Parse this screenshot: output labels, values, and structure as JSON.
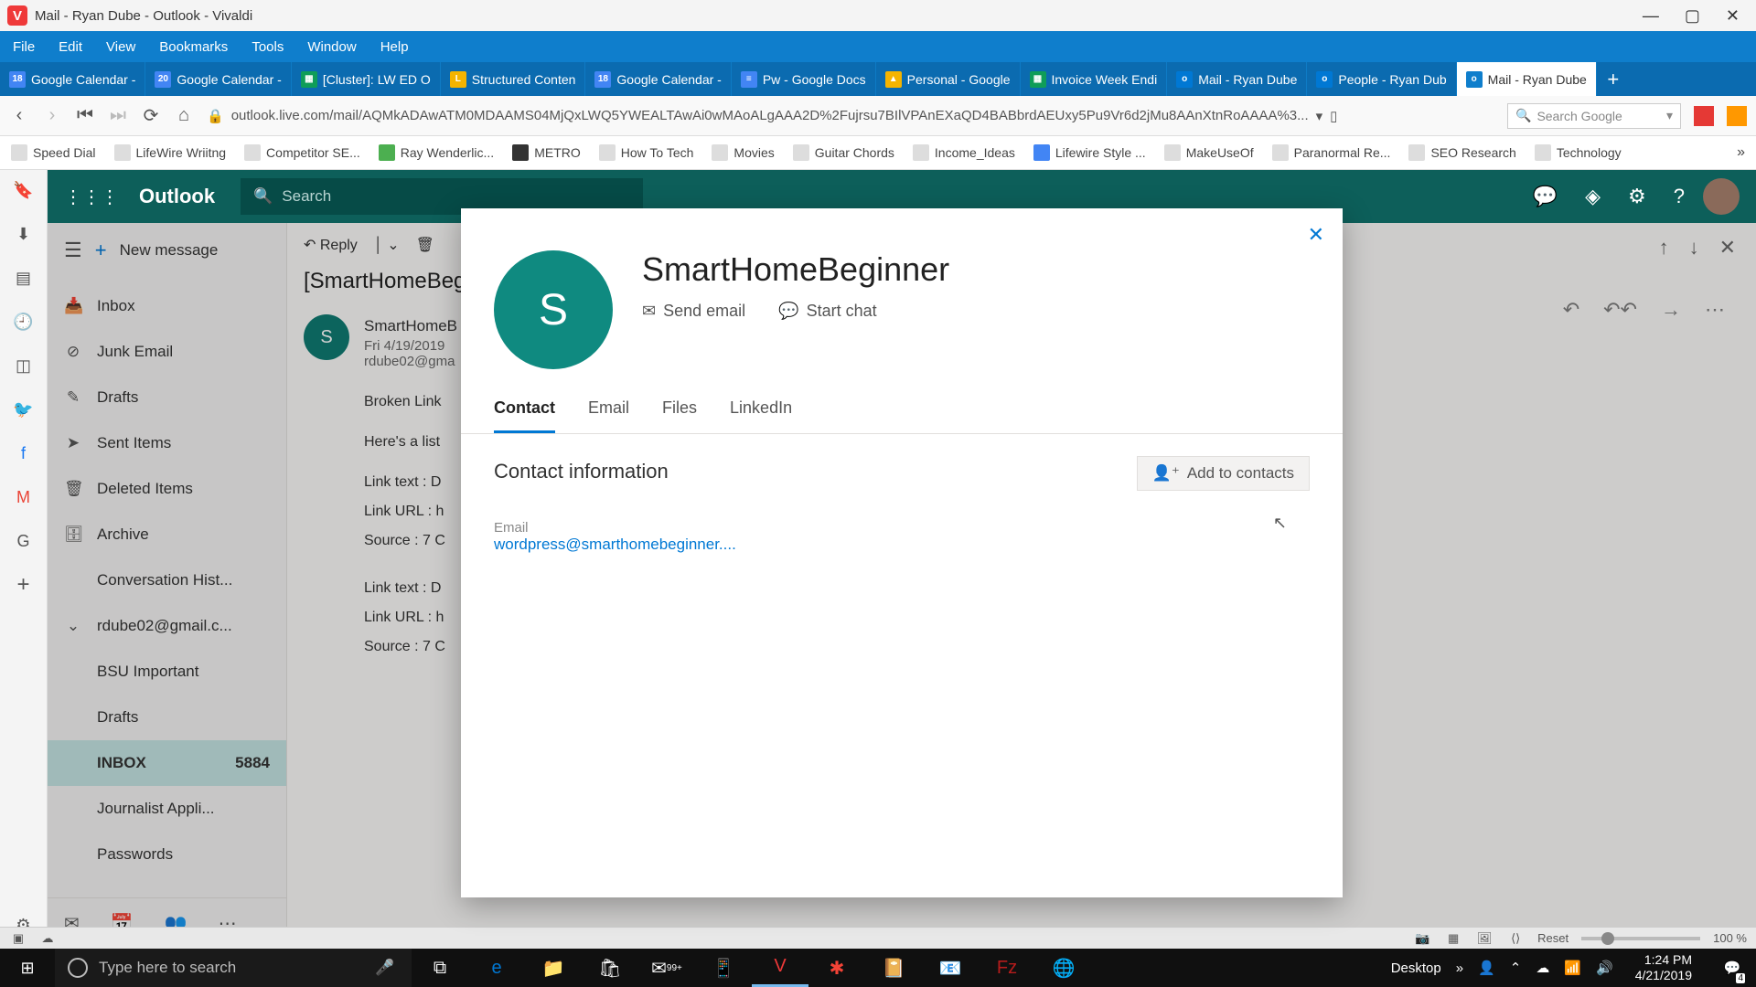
{
  "window": {
    "title": "Mail - Ryan Dube - Outlook - Vivaldi",
    "menu": [
      "File",
      "Edit",
      "View",
      "Bookmarks",
      "Tools",
      "Window",
      "Help"
    ]
  },
  "tabs": [
    {
      "icon": "18",
      "label": "Google Calendar -"
    },
    {
      "icon": "20",
      "label": "Google Calendar -"
    },
    {
      "icon": "▦",
      "label": "[Cluster]: LW ED O"
    },
    {
      "icon": "L",
      "label": "Structured Conten"
    },
    {
      "icon": "18",
      "label": "Google Calendar -"
    },
    {
      "icon": "≡",
      "label": "Pw - Google Docs"
    },
    {
      "icon": "▲",
      "label": "Personal - Google"
    },
    {
      "icon": "▦",
      "label": "Invoice Week Endi"
    },
    {
      "icon": "o",
      "label": "Mail - Ryan Dube"
    },
    {
      "icon": "o",
      "label": "People - Ryan Dub"
    },
    {
      "icon": "o",
      "label": "Mail - Ryan Dube",
      "active": true
    }
  ],
  "url": "outlook.live.com/mail/AQMkADAwATM0MDAAMS04MjQxLWQ5YWEALTAwAi0wMAoALgAAA2D%2Fujrsu7BIlVPAnEXaQD4BABbrdAEUxy5Pu9Vr6d2jMu8AAnXtnRoAAAA%3...",
  "search_placeholder": "Search Google",
  "bookmarks": [
    "Speed Dial",
    "LifeWire Wriitng",
    "Competitor SE...",
    "Ray Wenderlic...",
    "METRO",
    "How To Tech",
    "Movies",
    "Guitar Chords",
    "Income_Ideas",
    "Lifewire Style ...",
    "MakeUseOf",
    "Paranormal Re...",
    "SEO Research",
    "Technology"
  ],
  "outlook": {
    "brand": "Outlook",
    "search": "Search",
    "newmsg": "New message",
    "reply": "Reply",
    "folders": [
      {
        "icon": "📥",
        "label": "Inbox"
      },
      {
        "icon": "⊘",
        "label": "Junk Email"
      },
      {
        "icon": "✎",
        "label": "Drafts"
      },
      {
        "icon": "➤",
        "label": "Sent Items"
      },
      {
        "icon": "🗑",
        "label": "Deleted Items"
      },
      {
        "icon": "🗄",
        "label": "Archive"
      },
      {
        "icon": "",
        "label": "Conversation Hist...",
        "sub": true
      },
      {
        "icon": "⌄",
        "label": "rdube02@gmail.c..."
      },
      {
        "icon": "",
        "label": "BSU Important",
        "sub": true
      },
      {
        "icon": "",
        "label": "Drafts",
        "sub": true
      },
      {
        "icon": "",
        "label": "INBOX",
        "count": "5884",
        "sub": true,
        "selected": true
      },
      {
        "icon": "",
        "label": "Journalist Appli...",
        "sub": true
      },
      {
        "icon": "",
        "label": "Passwords",
        "sub": true
      }
    ],
    "subject": "[SmartHomeBeg",
    "sender": "SmartHomeB",
    "date": "Fri 4/19/2019",
    "to": "rdube02@gma",
    "body": {
      "l1": "Broken Link",
      "l2": "Here's a list",
      "l3": "Link text : D",
      "l4": "Link URL : h",
      "l5": "Source : 7 C",
      "l6": "Link text : D",
      "l7": "Link URL : h",
      "l8": "Source : 7 C"
    }
  },
  "card": {
    "initial": "S",
    "name": "SmartHomeBeginner",
    "send_email": "Send email",
    "start_chat": "Start chat",
    "tabs": [
      "Contact",
      "Email",
      "Files",
      "LinkedIn"
    ],
    "section": "Contact information",
    "add_btn": "Add to contacts",
    "email_label": "Email",
    "email_value": "wordpress@smarthomebeginner...."
  },
  "status": {
    "reset": "Reset",
    "zoom": "100 %"
  },
  "taskbar": {
    "search": "Type here to search",
    "desktop": "Desktop",
    "time": "1:24 PM",
    "date": "4/21/2019",
    "notif": "4"
  }
}
